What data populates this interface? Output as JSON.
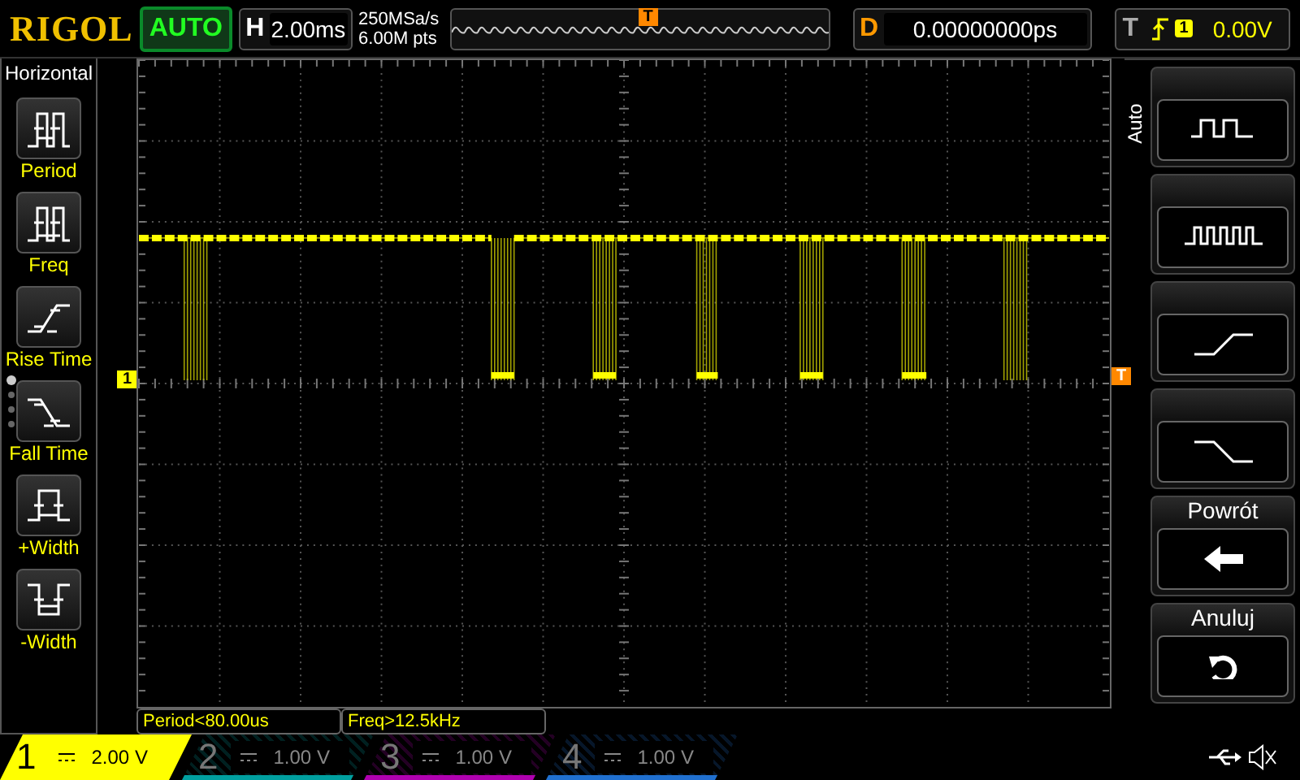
{
  "top_bar": {
    "brand": "RIGOL",
    "run_status": "AUTO",
    "timebase": {
      "label": "H",
      "value": "2.00ms"
    },
    "sample_rate": "250MSa/s",
    "memory_depth": "6.00M pts",
    "delay": {
      "label": "D",
      "value": "0.00000000ps"
    },
    "trigger": {
      "label": "T",
      "source": "1",
      "level": "0.00V"
    }
  },
  "left_menu": {
    "title": "Horizontal",
    "items": [
      {
        "label": "Period"
      },
      {
        "label": "Freq"
      },
      {
        "label": "Rise Time"
      },
      {
        "label": "Fall Time"
      },
      {
        "label": "+Width"
      },
      {
        "label": "-Width"
      }
    ]
  },
  "screen": {
    "trigger_position_marker": "T",
    "channel_marker": "1",
    "trigger_level_marker": "T"
  },
  "measurements": [
    "Period<80.00us",
    "Freq>12.5kHz"
  ],
  "right_menu": {
    "title": "Auto",
    "items": [
      {
        "kind": "icon"
      },
      {
        "kind": "icon"
      },
      {
        "kind": "icon"
      },
      {
        "kind": "icon"
      },
      {
        "kind": "labeled",
        "label": "Powrót"
      },
      {
        "kind": "labeled",
        "label": "Anuluj"
      }
    ]
  },
  "channels": [
    {
      "number": "1",
      "scale": "2.00 V",
      "selected": true,
      "color": "#ffff00"
    },
    {
      "number": "2",
      "scale": "1.00 V",
      "selected": false,
      "color": "#00a0a0"
    },
    {
      "number": "3",
      "scale": "1.00 V",
      "selected": false,
      "color": "#b000b0"
    },
    {
      "number": "4",
      "scale": "1.00 V",
      "selected": false,
      "color": "#2070d0"
    }
  ]
}
